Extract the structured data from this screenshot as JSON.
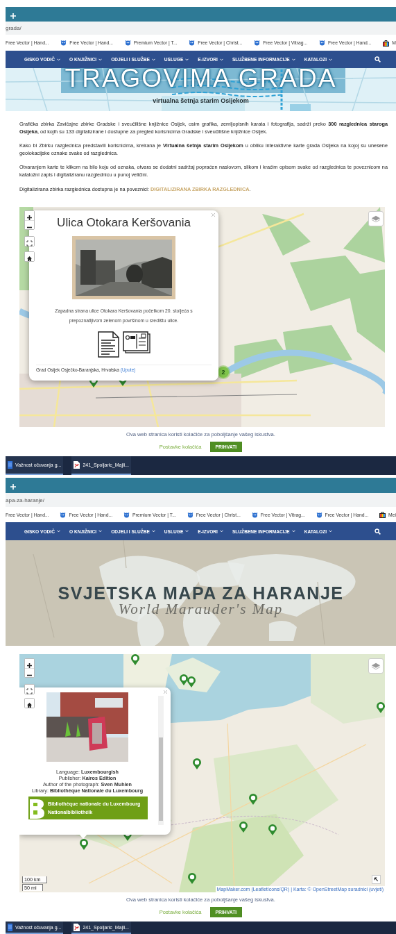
{
  "screens": [
    {
      "kind": "city",
      "address": "grada/",
      "bookmarks": [
        {
          "kind": "cut",
          "label": "Free Vector | Hand..."
        },
        {
          "kind": "site",
          "label": "Free Vector | Hand..."
        },
        {
          "kind": "site",
          "label": "Premium Vector | T..."
        },
        {
          "kind": "site",
          "label": "Free Vector | Christ..."
        },
        {
          "kind": "site",
          "label": "Free Vector | Vitrag..."
        },
        {
          "kind": "site",
          "label": "Free Vector | Hand..."
        },
        {
          "kind": "shop",
          "label": "M"
        }
      ],
      "nav": [
        "GISKO VODIČ",
        "O KNJIŽNICI",
        "ODJELI I SLUŽBE",
        "USLUGE",
        "E-IZVORI",
        "SLUŽBENE INFORMACIJE",
        "KATALOZI"
      ],
      "hero": {
        "title": "TRAGOVIMA GRADA",
        "subtitle": "virtualna šetnja starim Osijekom"
      },
      "paragraphs": [
        {
          "text": "Grafička zbirka Zavičajne zbirke Gradske i sveučilišne knjižnice Osijek, osim grafika, zemljopisnih karata i fotografija, sadrži preko **300 razglednica staroga Osijeka**, od kojih su 133 digitalizirane i dostupne za pregled korisnicima Gradske i sveučilišne knjižnice Osijek."
        },
        {
          "text": "Kako bi Zbirku razglednica predstavili korisnicima, kreirana je **Virtualna šetnja starim Osijekom** u obliku interaktivne karte grada Osijeka na kojoj su unesene geolokacijske oznake svake od razglednica."
        },
        {
          "text": "Otvaranjem karte te klikom na bilo koju od oznaka, otvara se dodatni sadržaj popraćen naslovom, slikom i kraćim opisom svake od razglednica te poveznicom na kataložni zapis i digitaliziranu razglednicu u punoj veličini."
        },
        {
          "text": "Digitalizirana zbirka razglednica dostupna je na poveznici: ",
          "link": "DIGITALIZIRANA ZBIRKA RAZGLEDNICA",
          "after": "."
        }
      ],
      "map": {
        "kind": "city",
        "cluster": "2",
        "popup": {
          "kind": "postcard",
          "title": "Ulica Otokara Keršovania",
          "description": "Zapadna strana ulice Otokara Keršovania početkom 20. stoljeća s prepoznatljivom zelenom površinom u središtu ulice.",
          "footer": "Grad Osijek Osječko-Baranjska, Hrvatska",
          "footer_link": "(Upute)"
        }
      },
      "cookie": {
        "message": "Ova web stranica koristi kolačiće za poboljšanje vašeg iskustva.",
        "settings": "Postavke kolačića",
        "accept": "PRIHVATI"
      },
      "taskbar": [
        {
          "kind": "doc",
          "label": "Važnost očuvanja g..."
        },
        {
          "kind": "pdf",
          "label": "241_Spoljaric_Majli..."
        }
      ]
    },
    {
      "kind": "world",
      "address": "apa-za-haranje/",
      "bookmarks": [
        {
          "kind": "cut",
          "label": "Free Vector | Hand..."
        },
        {
          "kind": "site",
          "label": "Free Vector | Hand..."
        },
        {
          "kind": "site",
          "label": "Premium Vector | T..."
        },
        {
          "kind": "site",
          "label": "Free Vector | Christ..."
        },
        {
          "kind": "site",
          "label": "Free Vector | Vitrag..."
        },
        {
          "kind": "site",
          "label": "Free Vector | Hand..."
        },
        {
          "kind": "shop",
          "label": "Mei"
        }
      ],
      "nav": [
        "GISKO VODIČ",
        "O KNJIŽNICI",
        "ODJELI I SLUŽBE",
        "USLUGE",
        "E-IZVORI",
        "SLUŽBENE INFORMACIJE",
        "KATALOZI"
      ],
      "hero": {
        "title": "SVJETSKA MAPA ZA HARANJE",
        "subtitle": "World Marauder's Map"
      },
      "map": {
        "kind": "world",
        "scale": [
          "100 km",
          "50 mi"
        ],
        "attribution": "MapMaker.com (LeafletIcons/QR) | Karta: © OpenStreetMap suradnici (uvjeti)",
        "popup": {
          "kind": "book",
          "fields": [
            {
              "label": "Language:",
              "value": "Luxembourgish"
            },
            {
              "label": "Publisher:",
              "value": "Kairos Edition"
            },
            {
              "label": "Author of the photograph:",
              "value": "Sven Muhlen"
            },
            {
              "label": "Library:",
              "value": "Bibliothèque Nationale du Luxembourg"
            }
          ],
          "logo": [
            "Bibliothèque nationale du Luxembourg",
            "Nationalbibliothéik"
          ]
        }
      },
      "cookie": {
        "message": "Ova web stranica koristi kolačiće za poboljšanje vašeg iskustva.",
        "settings": "Postavke kolačića",
        "accept": "PRIHVATI"
      },
      "taskbar": [
        {
          "kind": "doc",
          "label": "Važnost očuvanja g..."
        },
        {
          "kind": "pdf",
          "label": "241_Spoljaric_Majli..."
        }
      ]
    }
  ]
}
